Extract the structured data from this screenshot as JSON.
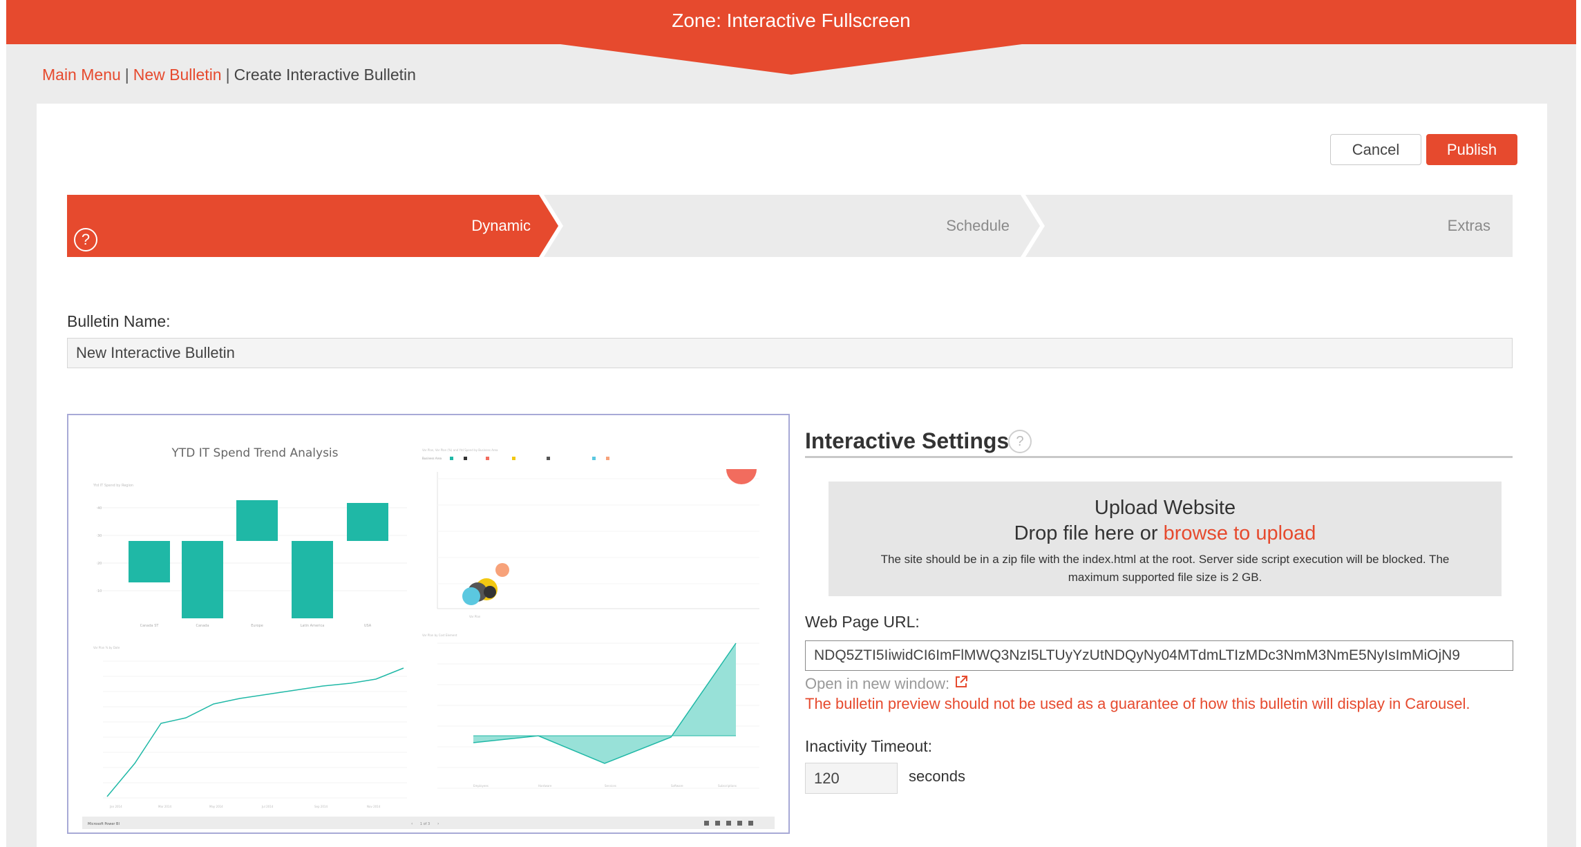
{
  "zone": {
    "title": "Zone: Interactive Fullscreen"
  },
  "breadcrumb": {
    "main_menu": "Main Menu",
    "new_bulletin": "New Bulletin",
    "current": "Create Interactive Bulletin",
    "separator": "|"
  },
  "toolbar": {
    "cancel_label": "Cancel",
    "publish_label": "Publish"
  },
  "steps": [
    {
      "label": "Dynamic",
      "active": true
    },
    {
      "label": "Schedule",
      "active": false
    },
    {
      "label": "Extras",
      "active": false
    }
  ],
  "help_glyph": "?",
  "bulletin_name": {
    "label": "Bulletin Name:",
    "value": "New Interactive Bulletin"
  },
  "preview": {
    "report_title": "YTD IT Spend Trend Analysis",
    "footer_left": "Microsoft Power BI",
    "pager": "1 of 3"
  },
  "settings": {
    "title": "Interactive Settings",
    "upload_title": "Upload Website",
    "drop_text": "Drop file here or",
    "browse_link": "browse to upload",
    "upload_note": "The site should be in a zip file with the index.html at the root. Server side script execution will be blocked. The maximum supported file size is 2 GB.",
    "url_label": "Web Page URL:",
    "url_value": "NDQ5ZTI5IiwidCI6ImFlMWQ3NzI5LTUyYzUtNDQyNy04MTdmLTIzMDc3NmM3NmE5NyIsImMiOjN9",
    "open_new_window": "Open in new window:",
    "warning": "The bulletin preview should not be used as a guarantee of how this bulletin will display in Carousel.",
    "timeout_label": "Inactivity Timeout:",
    "timeout_value": "120",
    "timeout_unit": "seconds"
  },
  "colors": {
    "accent": "#e64a2e",
    "teal": "#1fb8a6",
    "teal_light": "#98e1d8"
  },
  "icons": [
    "help-icon",
    "external-link-icon"
  ]
}
